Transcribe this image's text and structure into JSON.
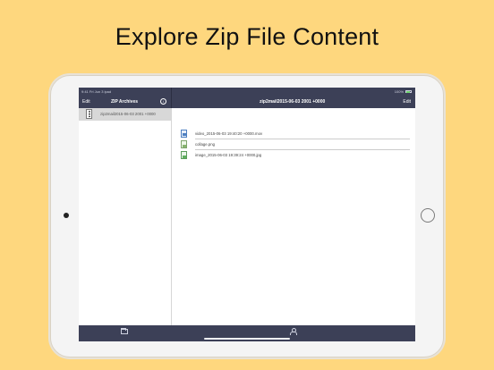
{
  "headline": "Explore Zip File Content",
  "status_bar": {
    "left": "9:41  Fri Jun 3  ipad",
    "right": "100%"
  },
  "nav": {
    "left_edit": "Edit",
    "left_title": "ZIP Archives",
    "info_glyph": "i",
    "right_title": "zip2mail2015-06-03 2001 +0000",
    "right_edit": "Edit"
  },
  "sidebar": {
    "items": [
      {
        "label": "zip2mail2015-06-03 2001 +0000",
        "icon": "zip-file-icon"
      }
    ]
  },
  "files": [
    {
      "label": "video_2015-06-03 19:40:20 +0000.mov",
      "icon": "mov-file-icon"
    },
    {
      "label": "collage.png",
      "icon": "png-file-icon"
    },
    {
      "label": "image_2015-06-03 19:39:24 +0000.jpg",
      "icon": "jpg-file-icon"
    }
  ],
  "tabbar": {
    "left_icon": "folder-icon",
    "right_icon": "person-icon"
  },
  "colors": {
    "background": "#FED77E",
    "bar": "#3C4057",
    "selected_row": "#D8D8D8"
  }
}
